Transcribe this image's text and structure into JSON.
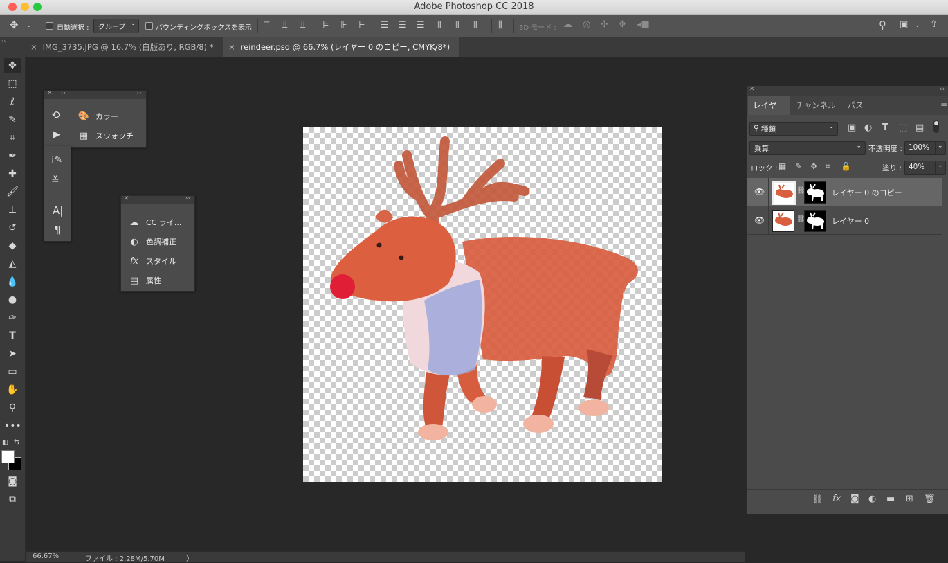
{
  "window": {
    "title": "Adobe Photoshop CC 2018",
    "traffic_lights": {
      "close": "#fe5f57",
      "minimize": "#febc2e",
      "zoom": "#28c840"
    }
  },
  "options_bar": {
    "auto_select_label": "自動選択 :",
    "auto_select_target": "グループ",
    "show_transform_label": "バウンディングボックスを表示",
    "mode_3d_label": "3D モード :"
  },
  "tabs": [
    {
      "label": "IMG_3735.JPG @ 16.7% (白版あり, RGB/8) *",
      "active": false
    },
    {
      "label": "reindeer.psd @ 66.7% (レイヤー 0 のコピー, CMYK/8*)",
      "active": true
    }
  ],
  "panel_colors": {
    "items": [
      {
        "icon": "palette-icon",
        "label": "カラー"
      },
      {
        "icon": "swatches-icon",
        "label": "スウォッチ"
      }
    ]
  },
  "panel_libs": {
    "items": [
      {
        "icon": "cc-libraries-icon",
        "label": "CC ライ..."
      },
      {
        "icon": "adjustments-icon",
        "label": "色調補正"
      },
      {
        "icon": "styles-icon",
        "label": "スタイル"
      },
      {
        "icon": "properties-icon",
        "label": "属性"
      }
    ]
  },
  "layers_panel": {
    "tabs": [
      "レイヤー",
      "チャンネル",
      "パス"
    ],
    "filter_kind": "種類",
    "blend_mode": "乗算",
    "opacity_label": "不透明度 :",
    "opacity_value": "100%",
    "lock_label": "ロック :",
    "fill_label": "塗り :",
    "fill_value": "40%",
    "layers": [
      {
        "name": "レイヤー 0 のコピー",
        "selected": true,
        "visible": true
      },
      {
        "name": "レイヤー 0",
        "selected": false,
        "visible": true
      }
    ]
  },
  "status_bar": {
    "zoom": "66.67%",
    "file_info": "ファイル : 2.28M/5.70M",
    "arrow": "〉"
  }
}
